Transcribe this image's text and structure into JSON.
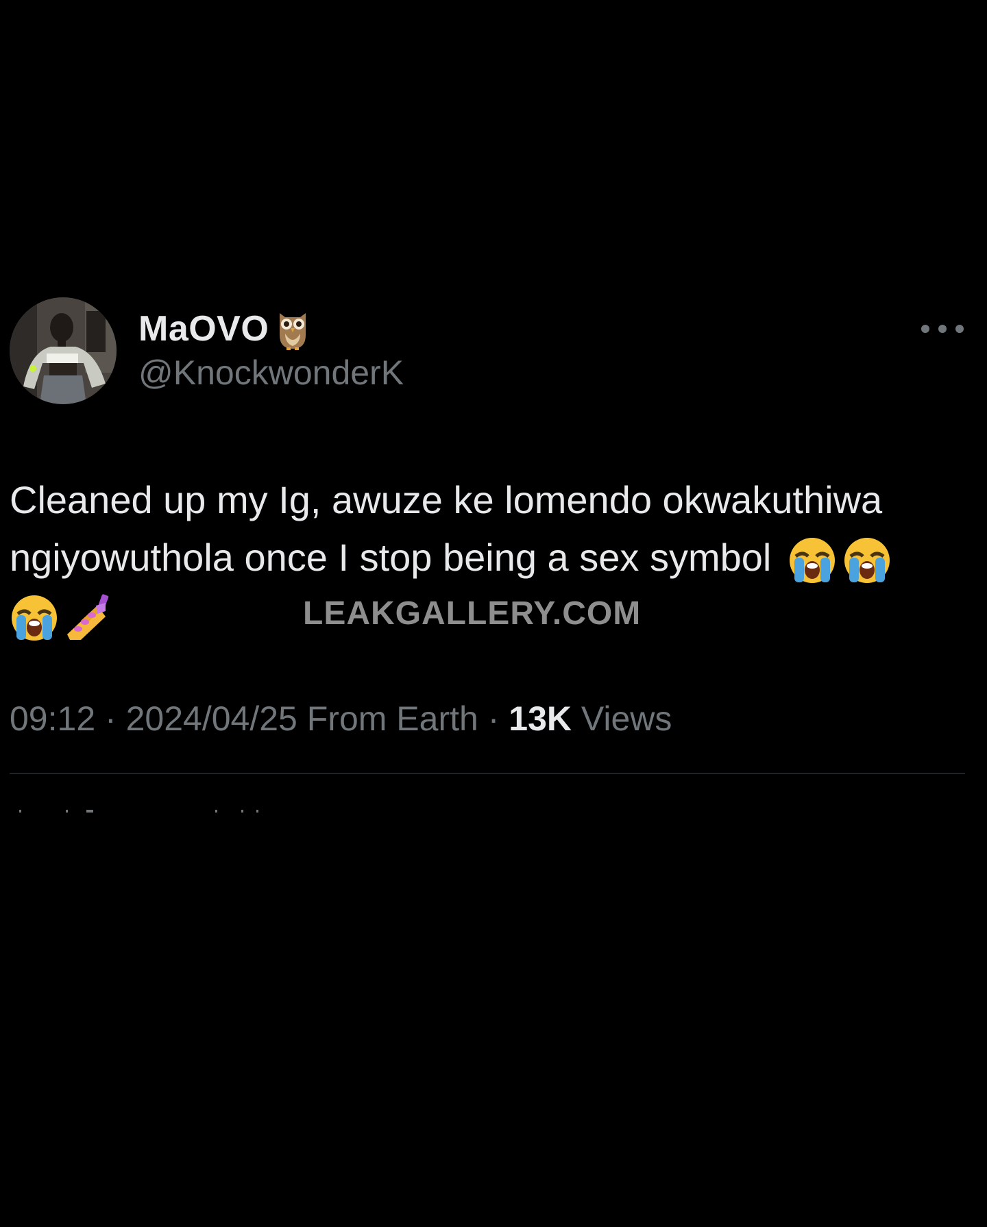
{
  "tweet": {
    "display_name": "MaOVO",
    "name_emoji": "owl-emoji",
    "handle": "@KnockwonderK",
    "text_line1": "Cleaned up my Ig, awuze ke lomendo okwakuthiwa",
    "text_line2": "ngiyowuthola once I stop being a sex symbol",
    "text_emojis": [
      "loudly-crying-face-emoji",
      "loudly-crying-face-emoji",
      "loudly-crying-face-emoji",
      "nail-polish-emoji"
    ],
    "time": "09:12",
    "date": "2024/04/25",
    "source": "From Earth",
    "separator": "·",
    "views_count": "13K",
    "views_label": "Views"
  },
  "watermark": "LEAKGALLERY.COM",
  "colors": {
    "background": "#000000",
    "primary_text": "#e7e9ea",
    "secondary_text": "#71767b",
    "divider": "#202327",
    "watermark": "#8e8e8e"
  }
}
